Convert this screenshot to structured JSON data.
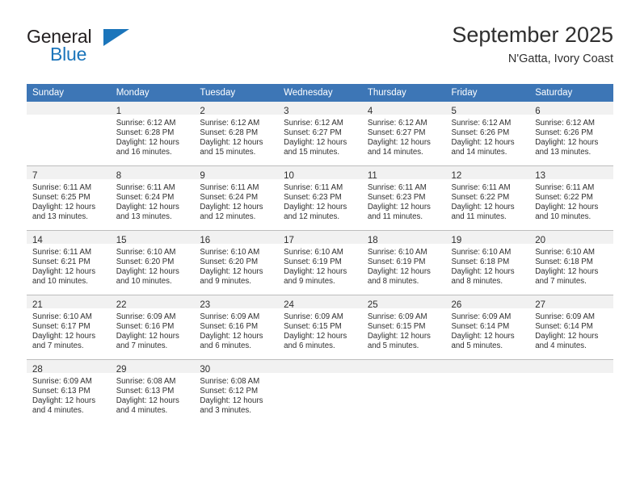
{
  "branding": {
    "logo_primary": "General",
    "logo_secondary": "Blue",
    "logo_accent_color": "#1b75bb"
  },
  "header": {
    "title": "September 2025",
    "location": "N'Gatta, Ivory Coast"
  },
  "theme": {
    "header_row_background": "#3d76b6",
    "header_row_text": "#ffffff",
    "daynum_strip_background": "#f1f1f1",
    "cell_border": "#bdbdbd",
    "text": "#2f2f2f"
  },
  "calendar": {
    "weekday_headers": [
      "Sunday",
      "Monday",
      "Tuesday",
      "Wednesday",
      "Thursday",
      "Friday",
      "Saturday"
    ],
    "weeks": [
      [
        {
          "empty": true
        },
        {
          "day": "1",
          "sunrise": "Sunrise: 6:12 AM",
          "sunset": "Sunset: 6:28 PM",
          "daylight_1": "Daylight: 12 hours",
          "daylight_2": "and 16 minutes."
        },
        {
          "day": "2",
          "sunrise": "Sunrise: 6:12 AM",
          "sunset": "Sunset: 6:28 PM",
          "daylight_1": "Daylight: 12 hours",
          "daylight_2": "and 15 minutes."
        },
        {
          "day": "3",
          "sunrise": "Sunrise: 6:12 AM",
          "sunset": "Sunset: 6:27 PM",
          "daylight_1": "Daylight: 12 hours",
          "daylight_2": "and 15 minutes."
        },
        {
          "day": "4",
          "sunrise": "Sunrise: 6:12 AM",
          "sunset": "Sunset: 6:27 PM",
          "daylight_1": "Daylight: 12 hours",
          "daylight_2": "and 14 minutes."
        },
        {
          "day": "5",
          "sunrise": "Sunrise: 6:12 AM",
          "sunset": "Sunset: 6:26 PM",
          "daylight_1": "Daylight: 12 hours",
          "daylight_2": "and 14 minutes."
        },
        {
          "day": "6",
          "sunrise": "Sunrise: 6:12 AM",
          "sunset": "Sunset: 6:26 PM",
          "daylight_1": "Daylight: 12 hours",
          "daylight_2": "and 13 minutes."
        }
      ],
      [
        {
          "day": "7",
          "sunrise": "Sunrise: 6:11 AM",
          "sunset": "Sunset: 6:25 PM",
          "daylight_1": "Daylight: 12 hours",
          "daylight_2": "and 13 minutes."
        },
        {
          "day": "8",
          "sunrise": "Sunrise: 6:11 AM",
          "sunset": "Sunset: 6:24 PM",
          "daylight_1": "Daylight: 12 hours",
          "daylight_2": "and 13 minutes."
        },
        {
          "day": "9",
          "sunrise": "Sunrise: 6:11 AM",
          "sunset": "Sunset: 6:24 PM",
          "daylight_1": "Daylight: 12 hours",
          "daylight_2": "and 12 minutes."
        },
        {
          "day": "10",
          "sunrise": "Sunrise: 6:11 AM",
          "sunset": "Sunset: 6:23 PM",
          "daylight_1": "Daylight: 12 hours",
          "daylight_2": "and 12 minutes."
        },
        {
          "day": "11",
          "sunrise": "Sunrise: 6:11 AM",
          "sunset": "Sunset: 6:23 PM",
          "daylight_1": "Daylight: 12 hours",
          "daylight_2": "and 11 minutes."
        },
        {
          "day": "12",
          "sunrise": "Sunrise: 6:11 AM",
          "sunset": "Sunset: 6:22 PM",
          "daylight_1": "Daylight: 12 hours",
          "daylight_2": "and 11 minutes."
        },
        {
          "day": "13",
          "sunrise": "Sunrise: 6:11 AM",
          "sunset": "Sunset: 6:22 PM",
          "daylight_1": "Daylight: 12 hours",
          "daylight_2": "and 10 minutes."
        }
      ],
      [
        {
          "day": "14",
          "sunrise": "Sunrise: 6:11 AM",
          "sunset": "Sunset: 6:21 PM",
          "daylight_1": "Daylight: 12 hours",
          "daylight_2": "and 10 minutes."
        },
        {
          "day": "15",
          "sunrise": "Sunrise: 6:10 AM",
          "sunset": "Sunset: 6:20 PM",
          "daylight_1": "Daylight: 12 hours",
          "daylight_2": "and 10 minutes."
        },
        {
          "day": "16",
          "sunrise": "Sunrise: 6:10 AM",
          "sunset": "Sunset: 6:20 PM",
          "daylight_1": "Daylight: 12 hours",
          "daylight_2": "and 9 minutes."
        },
        {
          "day": "17",
          "sunrise": "Sunrise: 6:10 AM",
          "sunset": "Sunset: 6:19 PM",
          "daylight_1": "Daylight: 12 hours",
          "daylight_2": "and 9 minutes."
        },
        {
          "day": "18",
          "sunrise": "Sunrise: 6:10 AM",
          "sunset": "Sunset: 6:19 PM",
          "daylight_1": "Daylight: 12 hours",
          "daylight_2": "and 8 minutes."
        },
        {
          "day": "19",
          "sunrise": "Sunrise: 6:10 AM",
          "sunset": "Sunset: 6:18 PM",
          "daylight_1": "Daylight: 12 hours",
          "daylight_2": "and 8 minutes."
        },
        {
          "day": "20",
          "sunrise": "Sunrise: 6:10 AM",
          "sunset": "Sunset: 6:18 PM",
          "daylight_1": "Daylight: 12 hours",
          "daylight_2": "and 7 minutes."
        }
      ],
      [
        {
          "day": "21",
          "sunrise": "Sunrise: 6:10 AM",
          "sunset": "Sunset: 6:17 PM",
          "daylight_1": "Daylight: 12 hours",
          "daylight_2": "and 7 minutes."
        },
        {
          "day": "22",
          "sunrise": "Sunrise: 6:09 AM",
          "sunset": "Sunset: 6:16 PM",
          "daylight_1": "Daylight: 12 hours",
          "daylight_2": "and 7 minutes."
        },
        {
          "day": "23",
          "sunrise": "Sunrise: 6:09 AM",
          "sunset": "Sunset: 6:16 PM",
          "daylight_1": "Daylight: 12 hours",
          "daylight_2": "and 6 minutes."
        },
        {
          "day": "24",
          "sunrise": "Sunrise: 6:09 AM",
          "sunset": "Sunset: 6:15 PM",
          "daylight_1": "Daylight: 12 hours",
          "daylight_2": "and 6 minutes."
        },
        {
          "day": "25",
          "sunrise": "Sunrise: 6:09 AM",
          "sunset": "Sunset: 6:15 PM",
          "daylight_1": "Daylight: 12 hours",
          "daylight_2": "and 5 minutes."
        },
        {
          "day": "26",
          "sunrise": "Sunrise: 6:09 AM",
          "sunset": "Sunset: 6:14 PM",
          "daylight_1": "Daylight: 12 hours",
          "daylight_2": "and 5 minutes."
        },
        {
          "day": "27",
          "sunrise": "Sunrise: 6:09 AM",
          "sunset": "Sunset: 6:14 PM",
          "daylight_1": "Daylight: 12 hours",
          "daylight_2": "and 4 minutes."
        }
      ],
      [
        {
          "day": "28",
          "sunrise": "Sunrise: 6:09 AM",
          "sunset": "Sunset: 6:13 PM",
          "daylight_1": "Daylight: 12 hours",
          "daylight_2": "and 4 minutes."
        },
        {
          "day": "29",
          "sunrise": "Sunrise: 6:08 AM",
          "sunset": "Sunset: 6:13 PM",
          "daylight_1": "Daylight: 12 hours",
          "daylight_2": "and 4 minutes."
        },
        {
          "day": "30",
          "sunrise": "Sunrise: 6:08 AM",
          "sunset": "Sunset: 6:12 PM",
          "daylight_1": "Daylight: 12 hours",
          "daylight_2": "and 3 minutes."
        },
        {
          "empty": true
        },
        {
          "empty": true
        },
        {
          "empty": true
        },
        {
          "empty": true
        }
      ]
    ]
  }
}
